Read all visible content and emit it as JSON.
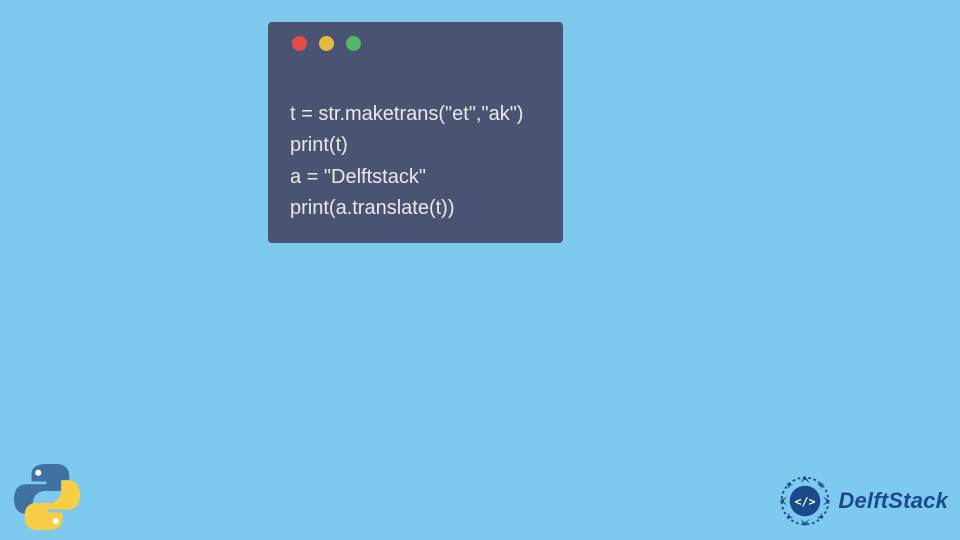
{
  "window": {
    "dots": [
      "red",
      "yellow",
      "green"
    ]
  },
  "code": {
    "lines": [
      "t = str.maketrans(\"et\",\"ak\")",
      "print(t)",
      "a = \"Delftstack\"",
      "print(a.translate(t))"
    ]
  },
  "branding": {
    "text": "DelftStack"
  },
  "colors": {
    "bg": "#7ec9ee",
    "window": "#4a5472",
    "code_text": "#e8eaf0",
    "dot_red": "#e94b4b",
    "dot_yellow": "#e8b93f",
    "dot_green": "#53b66a",
    "brand": "#1b4a8a",
    "python_blue": "#3f72a3",
    "python_yellow": "#f7ce46"
  }
}
